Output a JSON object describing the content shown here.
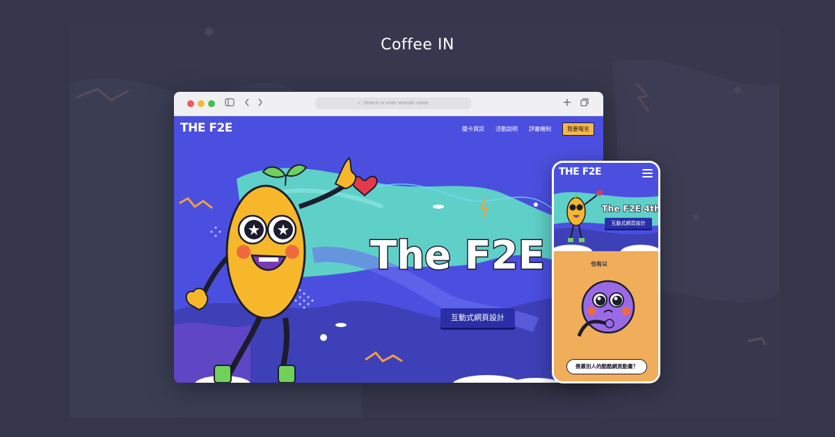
{
  "header": {
    "title": "Coffee IN"
  },
  "browser": {
    "url_placeholder": "Search or enter website name",
    "icons": [
      "sidebar-icon",
      "back-icon",
      "forward-icon",
      "new-tab-icon",
      "tabs-overview-icon"
    ]
  },
  "site": {
    "logo": "THE F2E",
    "nav": [
      "關卡資訊",
      "活動說明",
      "評審機制"
    ],
    "cta": "我要報名",
    "hero_title": "The F2E 4th",
    "hero_button": "互動式網頁設計"
  },
  "mobile": {
    "logo": "THE F2E",
    "hero_title": "The F2E 4th",
    "hero_button": "互動式網頁設計",
    "peek_text": "也有以",
    "cta": "羨慕別人的酷酷網頁動畫？"
  },
  "colors": {
    "page_bg": "#35364a",
    "site_blue": "#4b4fe0",
    "accent_orange": "#f7b64a",
    "mascot_yellow": "#f6b82a"
  }
}
